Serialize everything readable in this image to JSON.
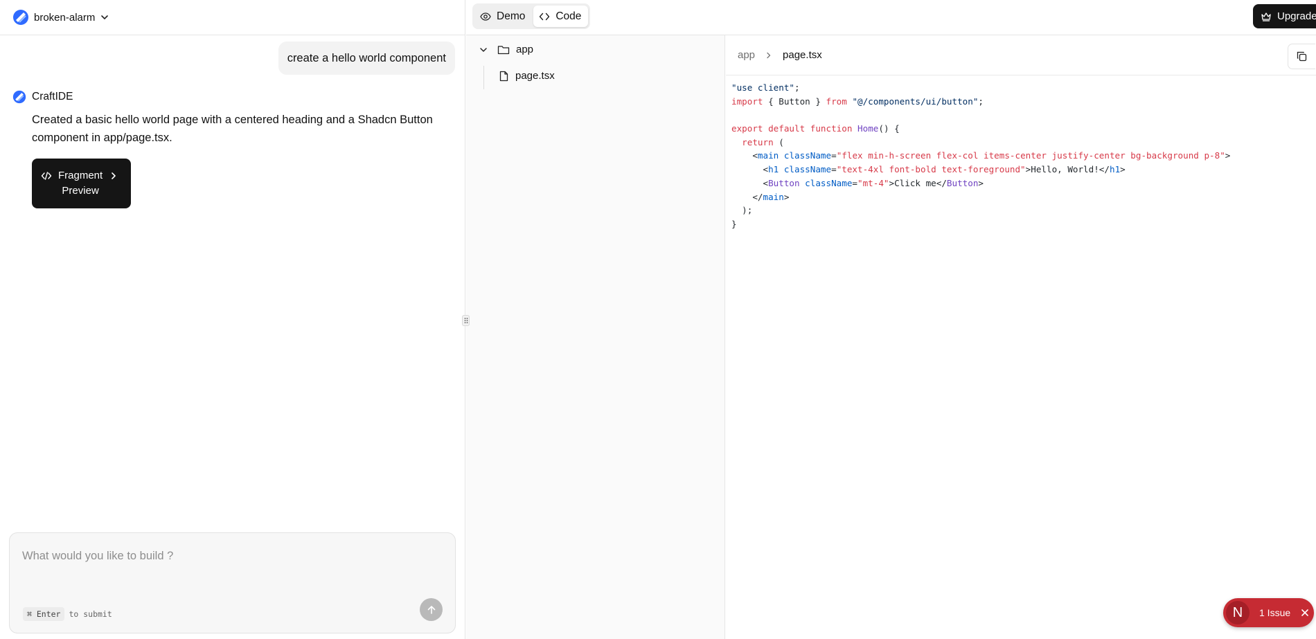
{
  "header": {
    "project_name": "broken-alarm",
    "tabs": [
      {
        "label": "Demo",
        "icon": "eye-icon",
        "active": false
      },
      {
        "label": "Code",
        "icon": "code-icon",
        "active": true
      }
    ],
    "upgrade_label": "Upgrade"
  },
  "chat": {
    "user_message": "create a hello world component",
    "assistant": {
      "name": "CraftIDE",
      "message": "Created a basic hello world page with a centered heading and a Shadcn Button component in app/page.tsx.",
      "fragment_card_label_line1": "Fragment",
      "fragment_card_label_line2": "Preview"
    },
    "composer": {
      "placeholder": "What would you like to build ?",
      "value": "",
      "shortcut_key": "⌘ Enter",
      "shortcut_hint": "to submit"
    }
  },
  "file_tree": {
    "folder": "app",
    "files": [
      "page.tsx"
    ]
  },
  "editor": {
    "breadcrumb": [
      "app",
      "page.tsx"
    ],
    "code_lines": [
      "\"use client\";",
      "import { Button } from \"@/components/ui/button\";",
      "",
      "export default function Home() {",
      "  return (",
      "    <main className=\"flex min-h-screen flex-col items-center justify-center bg-background p-8\">",
      "      <h1 className=\"text-4xl font-bold text-foreground\">Hello, World!</h1>",
      "      <Button className=\"mt-4\">Click me</Button>",
      "    </main>",
      "  );",
      "}"
    ]
  },
  "issues": {
    "label": "1 Issue",
    "logo_letter": "N"
  },
  "colors": {
    "accent_dark": "#151515",
    "issue_red": "#c62b33",
    "logo_blue": "#2f6bff"
  }
}
